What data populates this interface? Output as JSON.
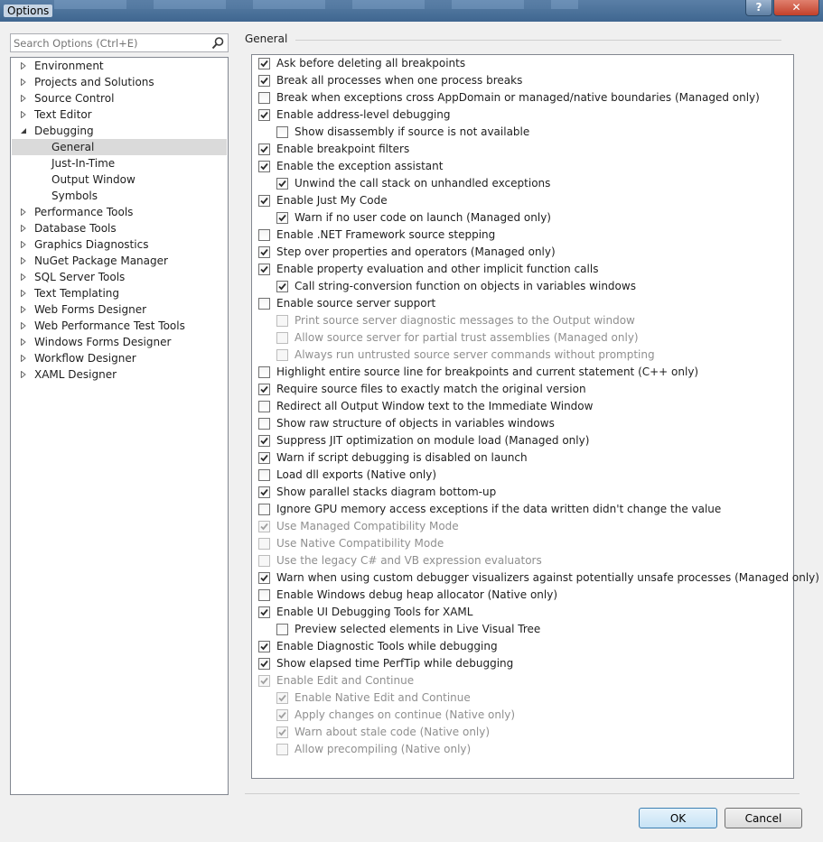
{
  "window": {
    "title": "Options",
    "help_glyph": "?",
    "close_glyph": "✕"
  },
  "search": {
    "placeholder": "Search Options (Ctrl+E)",
    "icon": "search-icon"
  },
  "tree": {
    "items": [
      {
        "label": "Environment",
        "level": 0,
        "expander": "collapsed"
      },
      {
        "label": "Projects and Solutions",
        "level": 0,
        "expander": "collapsed"
      },
      {
        "label": "Source Control",
        "level": 0,
        "expander": "collapsed"
      },
      {
        "label": "Text Editor",
        "level": 0,
        "expander": "collapsed"
      },
      {
        "label": "Debugging",
        "level": 0,
        "expander": "expanded"
      },
      {
        "label": "General",
        "level": 1,
        "selected": true
      },
      {
        "label": "Just-In-Time",
        "level": 1
      },
      {
        "label": "Output Window",
        "level": 1
      },
      {
        "label": "Symbols",
        "level": 1
      },
      {
        "label": "Performance Tools",
        "level": 0,
        "expander": "collapsed"
      },
      {
        "label": "Database Tools",
        "level": 0,
        "expander": "collapsed"
      },
      {
        "label": "Graphics Diagnostics",
        "level": 0,
        "expander": "collapsed"
      },
      {
        "label": "NuGet Package Manager",
        "level": 0,
        "expander": "collapsed"
      },
      {
        "label": "SQL Server Tools",
        "level": 0,
        "expander": "collapsed"
      },
      {
        "label": "Text Templating",
        "level": 0,
        "expander": "collapsed"
      },
      {
        "label": "Web Forms Designer",
        "level": 0,
        "expander": "collapsed"
      },
      {
        "label": "Web Performance Test Tools",
        "level": 0,
        "expander": "collapsed"
      },
      {
        "label": "Windows Forms Designer",
        "level": 0,
        "expander": "collapsed"
      },
      {
        "label": "Workflow Designer",
        "level": 0,
        "expander": "collapsed"
      },
      {
        "label": "XAML Designer",
        "level": 0,
        "expander": "collapsed"
      }
    ]
  },
  "general": {
    "group_title": "General",
    "options": [
      {
        "label": "Ask before deleting all breakpoints",
        "checked": true,
        "indent": 0,
        "enabled": true
      },
      {
        "label": "Break all processes when one process breaks",
        "checked": true,
        "indent": 0,
        "enabled": true
      },
      {
        "label": "Break when exceptions cross AppDomain or managed/native boundaries (Managed only)",
        "checked": false,
        "indent": 0,
        "enabled": true
      },
      {
        "label": "Enable address-level debugging",
        "checked": true,
        "indent": 0,
        "enabled": true
      },
      {
        "label": "Show disassembly if source is not available",
        "checked": false,
        "indent": 1,
        "enabled": true
      },
      {
        "label": "Enable breakpoint filters",
        "checked": true,
        "indent": 0,
        "enabled": true
      },
      {
        "label": "Enable the exception assistant",
        "checked": true,
        "indent": 0,
        "enabled": true
      },
      {
        "label": "Unwind the call stack on unhandled exceptions",
        "checked": true,
        "indent": 1,
        "enabled": true
      },
      {
        "label": "Enable Just My Code",
        "checked": true,
        "indent": 0,
        "enabled": true
      },
      {
        "label": "Warn if no user code on launch (Managed only)",
        "checked": true,
        "indent": 1,
        "enabled": true
      },
      {
        "label": "Enable .NET Framework source stepping",
        "checked": false,
        "indent": 0,
        "enabled": true
      },
      {
        "label": "Step over properties and operators (Managed only)",
        "checked": true,
        "indent": 0,
        "enabled": true
      },
      {
        "label": "Enable property evaluation and other implicit function calls",
        "checked": true,
        "indent": 0,
        "enabled": true
      },
      {
        "label": "Call string-conversion function on objects in variables windows",
        "checked": true,
        "indent": 1,
        "enabled": true
      },
      {
        "label": "Enable source server support",
        "checked": false,
        "indent": 0,
        "enabled": true
      },
      {
        "label": "Print source server diagnostic messages to the Output window",
        "checked": false,
        "indent": 1,
        "enabled": false
      },
      {
        "label": "Allow source server for partial trust assemblies (Managed only)",
        "checked": false,
        "indent": 1,
        "enabled": false
      },
      {
        "label": "Always run untrusted source server commands without prompting",
        "checked": false,
        "indent": 1,
        "enabled": false
      },
      {
        "label": "Highlight entire source line for breakpoints and current statement (C++ only)",
        "checked": false,
        "indent": 0,
        "enabled": true
      },
      {
        "label": "Require source files to exactly match the original version",
        "checked": true,
        "indent": 0,
        "enabled": true
      },
      {
        "label": "Redirect all Output Window text to the Immediate Window",
        "checked": false,
        "indent": 0,
        "enabled": true
      },
      {
        "label": "Show raw structure of objects in variables windows",
        "checked": false,
        "indent": 0,
        "enabled": true
      },
      {
        "label": "Suppress JIT optimization on module load (Managed only)",
        "checked": true,
        "indent": 0,
        "enabled": true
      },
      {
        "label": "Warn if script debugging is disabled on launch",
        "checked": true,
        "indent": 0,
        "enabled": true
      },
      {
        "label": "Load dll exports (Native only)",
        "checked": false,
        "indent": 0,
        "enabled": true
      },
      {
        "label": "Show parallel stacks diagram bottom-up",
        "checked": true,
        "indent": 0,
        "enabled": true
      },
      {
        "label": "Ignore GPU memory access exceptions if the data written didn't change the value",
        "checked": false,
        "indent": 0,
        "enabled": true
      },
      {
        "label": "Use Managed Compatibility Mode",
        "checked": true,
        "indent": 0,
        "enabled": false
      },
      {
        "label": "Use Native Compatibility Mode",
        "checked": false,
        "indent": 0,
        "enabled": false
      },
      {
        "label": "Use the legacy C# and VB expression evaluators",
        "checked": false,
        "indent": 0,
        "enabled": false
      },
      {
        "label": "Warn when using custom debugger visualizers against potentially unsafe processes (Managed only)",
        "checked": true,
        "indent": 0,
        "enabled": true
      },
      {
        "label": "Enable Windows debug heap allocator (Native only)",
        "checked": false,
        "indent": 0,
        "enabled": true
      },
      {
        "label": "Enable UI Debugging Tools for XAML",
        "checked": true,
        "indent": 0,
        "enabled": true
      },
      {
        "label": "Preview selected elements in Live Visual Tree",
        "checked": false,
        "indent": 1,
        "enabled": true
      },
      {
        "label": "Enable Diagnostic Tools while debugging",
        "checked": true,
        "indent": 0,
        "enabled": true
      },
      {
        "label": "Show elapsed time PerfTip while debugging",
        "checked": true,
        "indent": 0,
        "enabled": true
      },
      {
        "label": "Enable Edit and Continue",
        "checked": true,
        "indent": 0,
        "enabled": false
      },
      {
        "label": "Enable Native Edit and Continue",
        "checked": true,
        "indent": 1,
        "enabled": false
      },
      {
        "label": "Apply changes on continue (Native only)",
        "checked": true,
        "indent": 1,
        "enabled": false
      },
      {
        "label": "Warn about stale code (Native only)",
        "checked": true,
        "indent": 1,
        "enabled": false
      },
      {
        "label": "Allow precompiling (Native only)",
        "checked": false,
        "indent": 1,
        "enabled": false
      }
    ]
  },
  "buttons": {
    "ok_label": "OK",
    "cancel_label": "Cancel"
  },
  "colors": {
    "selection": "#dadada",
    "titlebar": "#4a729b",
    "ok_border": "#3c7fb1"
  }
}
